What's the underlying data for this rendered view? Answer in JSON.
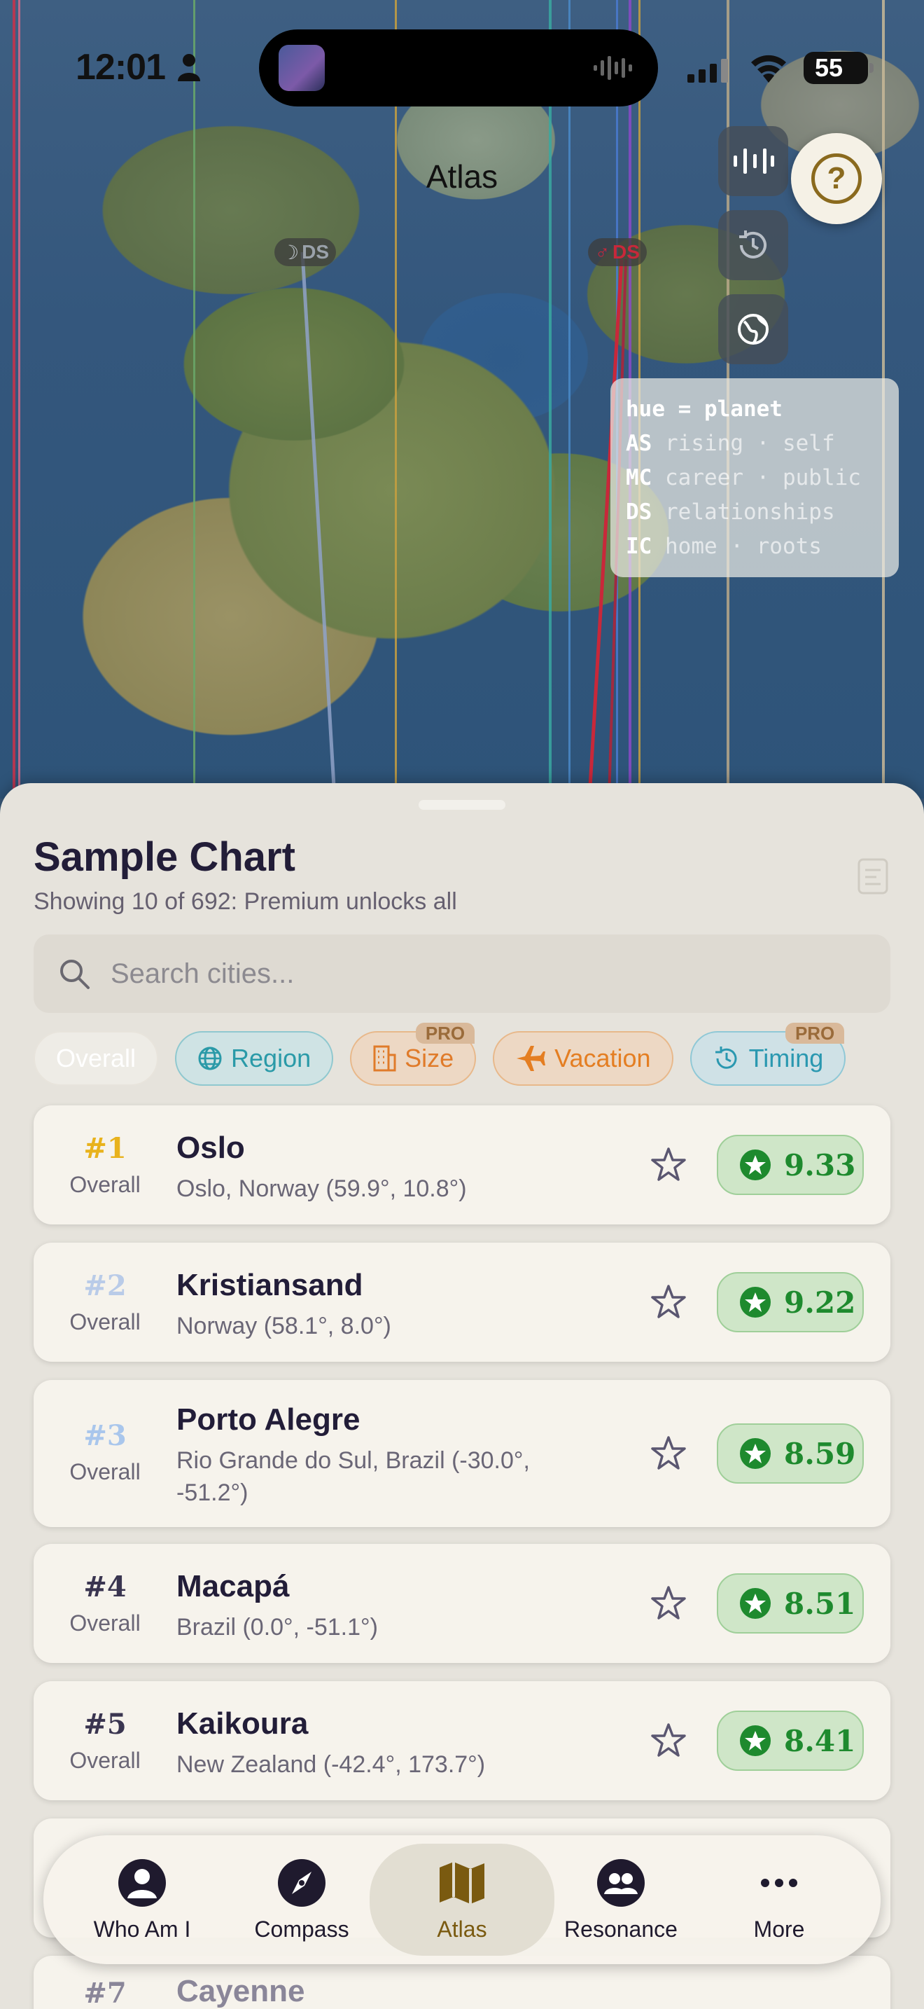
{
  "status": {
    "time": "12:01",
    "battery": "55"
  },
  "map": {
    "title": "Atlas",
    "tags": [
      "DS",
      "DS"
    ],
    "legend": {
      "header": "hue = planet",
      "rows": [
        {
          "key": "AS",
          "value": "rising · self"
        },
        {
          "key": "MC",
          "value": "career · public"
        },
        {
          "key": "DS",
          "value": "relationships"
        },
        {
          "key": "IC",
          "value": "home · roots"
        }
      ]
    }
  },
  "sheet": {
    "title": "Sample Chart",
    "subtitle": "Showing 10 of 692: Premium unlocks all",
    "search_placeholder": "Search cities...",
    "chips": [
      {
        "label": "Overall",
        "pro": ""
      },
      {
        "label": "Region",
        "pro": ""
      },
      {
        "label": "Size",
        "pro": "PRO"
      },
      {
        "label": "Vacation",
        "pro": ""
      },
      {
        "label": "Timing",
        "pro": "PRO"
      }
    ],
    "cities": [
      {
        "rank": "#1",
        "rank_label": "Overall",
        "name": "Oslo",
        "location": "Oslo, Norway (59.9°, 10.8°)",
        "score": "9.33",
        "rank_color": "#e8b21c"
      },
      {
        "rank": "#2",
        "rank_label": "Overall",
        "name": "Kristiansand",
        "location": "Norway (58.1°, 8.0°)",
        "score": "9.22",
        "rank_color": "#b9cbe8"
      },
      {
        "rank": "#3",
        "rank_label": "Overall",
        "name": "Porto Alegre",
        "location": "Rio Grande do Sul, Brazil (-30.0°, -51.2°)",
        "score": "8.59",
        "rank_color": "#a9c6ec"
      },
      {
        "rank": "#4",
        "rank_label": "Overall",
        "name": "Macapá",
        "location": "Brazil (0.0°, -51.1°)",
        "score": "8.51",
        "rank_color": "#3a3550"
      },
      {
        "rank": "#5",
        "rank_label": "Overall",
        "name": "Kaikoura",
        "location": "New Zealand (-42.4°, 173.7°)",
        "score": "8.41",
        "rank_color": "#3a3550"
      },
      {
        "rank": "#7",
        "rank_label": "",
        "name": "Cayenne",
        "location": "",
        "score": "",
        "rank_color": "#3a3550"
      }
    ]
  },
  "tabs": [
    {
      "label": "Who Am I",
      "icon": "person-icon"
    },
    {
      "label": "Compass",
      "icon": "compass-icon"
    },
    {
      "label": "Atlas",
      "icon": "map-icon"
    },
    {
      "label": "Resonance",
      "icon": "people-icon"
    },
    {
      "label": "More",
      "icon": "more-icon"
    }
  ]
}
